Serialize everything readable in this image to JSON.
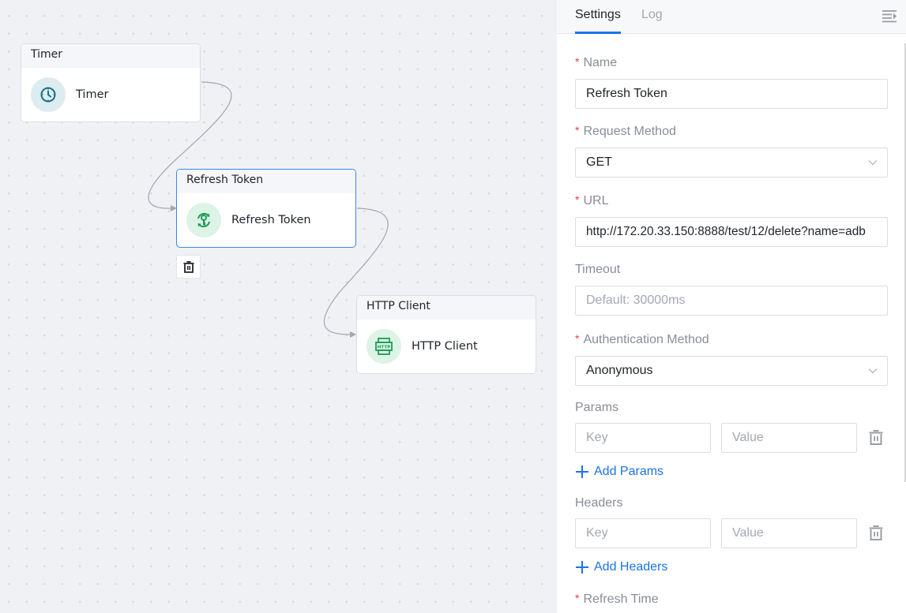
{
  "canvas": {
    "nodes": [
      {
        "id": "timer",
        "header": "Timer",
        "label": "Timer",
        "icon": "clock-icon",
        "icon_color": "#1b6f86",
        "icon_bg": "#dcecef",
        "selected": false
      },
      {
        "id": "refresh-token",
        "header": "Refresh Token",
        "label": "Refresh Token",
        "icon": "key-refresh-icon",
        "icon_color": "#1e9b57",
        "icon_bg": "#dcf3e6",
        "selected": true
      },
      {
        "id": "http-client",
        "header": "HTTP Client",
        "label": "HTTP Client",
        "icon": "http-icon",
        "icon_color": "#1e9b57",
        "icon_bg": "#dcf3e6",
        "selected": false
      }
    ],
    "edges": [
      {
        "from": "timer",
        "to": "refresh-token"
      },
      {
        "from": "refresh-token",
        "to": "http-client"
      }
    ],
    "selected_node_action": "delete-node"
  },
  "panel": {
    "tabs": [
      {
        "label": "Settings",
        "active": true
      },
      {
        "label": "Log",
        "active": false
      }
    ],
    "collapse_icon": "collapse-panel-icon",
    "fields": {
      "name": {
        "label": "Name",
        "required": true,
        "value": "Refresh Token"
      },
      "request_method": {
        "label": "Request Method",
        "required": true,
        "value": "GET"
      },
      "url": {
        "label": "URL",
        "required": true,
        "value": "http://172.20.33.150:8888/test/12/delete?name=adb"
      },
      "timeout": {
        "label": "Timeout",
        "required": false,
        "placeholder": "Default: 30000ms"
      },
      "auth_method": {
        "label": "Authentication Method",
        "required": true,
        "value": "Anonymous"
      },
      "params": {
        "label": "Params",
        "key_placeholder": "Key",
        "value_placeholder": "Value",
        "add_label": "Add Params"
      },
      "headers": {
        "label": "Headers",
        "key_placeholder": "Key",
        "value_placeholder": "Value",
        "add_label": "Add Headers"
      },
      "refresh_time": {
        "label": "Refresh Time",
        "required": true
      }
    },
    "required_marker": "*",
    "colors": {
      "accent": "#1a73e8",
      "required": "#f03a3a",
      "selected_border": "#3b86ee"
    }
  }
}
